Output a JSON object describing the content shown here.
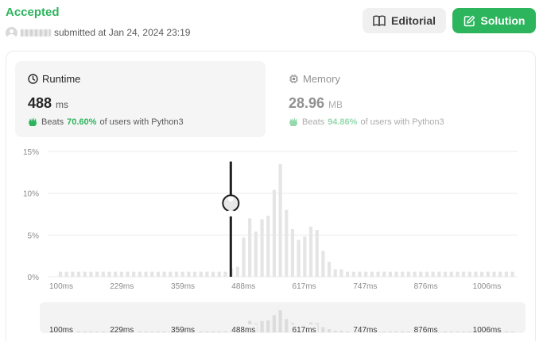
{
  "submission": {
    "status": "Accepted",
    "submitted_text": "submitted at Jan 24, 2024 23:19"
  },
  "buttons": {
    "editorial_label": "Editorial",
    "solution_label": "Solution"
  },
  "metrics": {
    "runtime": {
      "title": "Runtime",
      "value": "488",
      "unit": "ms",
      "beats_label": "Beats",
      "beats_pct": "70.60%",
      "beats_suffix": "of users with Python3"
    },
    "memory": {
      "title": "Memory",
      "value": "28.96",
      "unit": "MB",
      "beats_label": "Beats",
      "beats_pct": "94.86%",
      "beats_suffix": "of users with Python3"
    }
  },
  "colors": {
    "accent": "#2db55d",
    "bar": "#e5e5e5",
    "marker": "#1f1f1f"
  },
  "icons": {
    "editorial": "book-icon",
    "solution": "edit-icon",
    "runtime": "clock-icon",
    "memory": "chip-icon",
    "beats": "clap-icon"
  },
  "chart_data": {
    "type": "bar",
    "title": "",
    "xlabel": "",
    "ylabel": "",
    "y_ticks": [
      "15%",
      "10%",
      "5%",
      "0%"
    ],
    "ylim": [
      0,
      15
    ],
    "x_ticks": [
      "100ms",
      "229ms",
      "359ms",
      "488ms",
      "617ms",
      "747ms",
      "876ms",
      "1006ms"
    ],
    "x_tick_values": [
      100,
      229,
      359,
      488,
      617,
      747,
      876,
      1006
    ],
    "xlim": [
      100,
      1100
    ],
    "bin_width": 13,
    "bin_start": 100,
    "values": [
      0.6,
      0.6,
      0.6,
      0.6,
      0.6,
      0.6,
      0.6,
      0.6,
      0.6,
      0.6,
      0.6,
      0.6,
      0.6,
      0.6,
      0.6,
      0.6,
      0.6,
      0.6,
      0.6,
      0.6,
      0.6,
      0.6,
      0.6,
      0.6,
      0.6,
      0.6,
      0.6,
      0.6,
      1.0,
      1.2,
      4.7,
      7.0,
      5.4,
      6.9,
      7.3,
      10.4,
      13.5,
      8.0,
      5.7,
      4.4,
      4.8,
      6.0,
      5.6,
      3.1,
      1.8,
      0.9,
      0.9,
      0.6,
      0.6,
      0.6,
      0.6,
      0.6,
      0.6,
      0.6,
      0.6,
      0.6,
      0.6,
      0.6,
      0.6,
      0.6,
      0.6,
      0.6,
      0.6,
      0.6,
      0.6,
      0.6,
      0.6,
      0.6,
      0.6,
      0.6,
      0.6,
      0.6,
      0.6,
      0.6,
      0.6,
      0.6,
      0.6
    ],
    "highlight": {
      "x": 488
    },
    "grid": true,
    "overview": {
      "x_ticks": [
        "100ms",
        "229ms",
        "359ms",
        "488ms",
        "617ms",
        "747ms",
        "876ms",
        "1006ms"
      ]
    }
  }
}
